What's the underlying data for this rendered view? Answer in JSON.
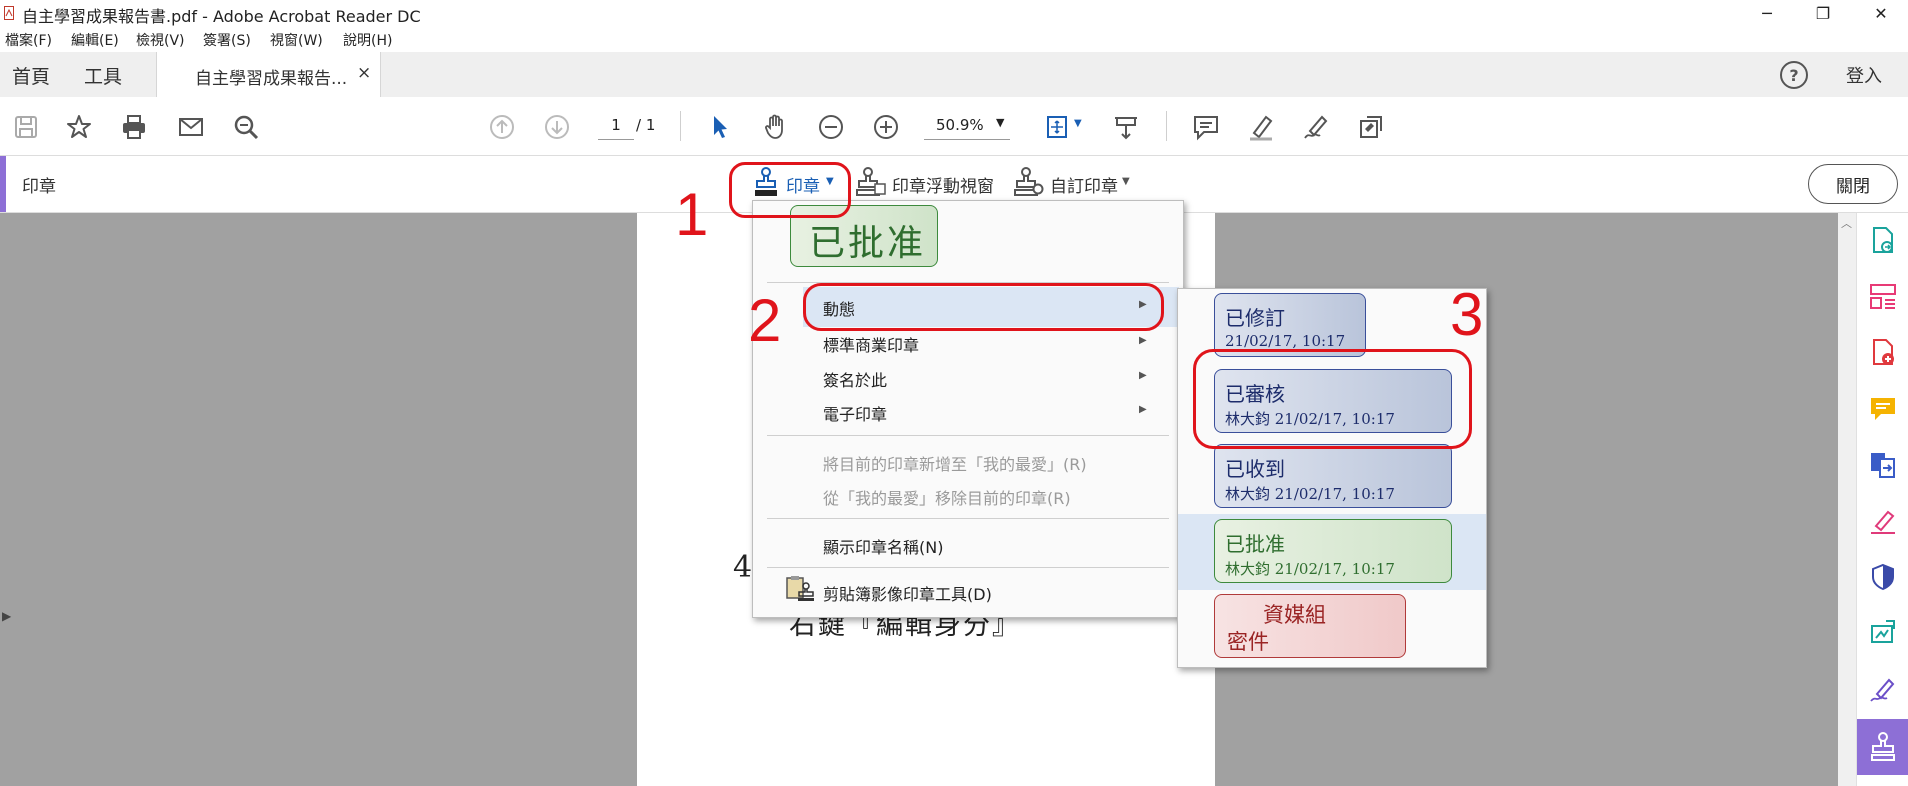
{
  "window": {
    "title": "自主學習成果報告書.pdf - Adobe Acrobat Reader DC",
    "minimize": "─",
    "restore": "❐",
    "close": "✕"
  },
  "menu": [
    "檔案(F)",
    "編輯(E)",
    "檢視(V)",
    "簽署(S)",
    "視窗(W)",
    "說明(H)"
  ],
  "tabs": {
    "home": "首頁",
    "tools": "工具",
    "document": "自主學習成果報告...",
    "close": "×",
    "help": "?",
    "signin": "登入"
  },
  "toolbar": {
    "page_current": "1",
    "page_total": "/ 1",
    "zoom": "50.9%",
    "icons": [
      "save-icon",
      "star-icon",
      "print-icon",
      "mail-icon",
      "search-icon",
      "prev-page-icon",
      "next-page-icon",
      "select-arrow-icon",
      "hand-icon",
      "zoom-out-icon",
      "zoom-in-icon",
      "fit-icon",
      "scroll-icon",
      "comment-icon",
      "highlight-icon",
      "sign-icon",
      "stamp-edit-icon"
    ]
  },
  "stampbar": {
    "title": "印章",
    "stamp": "印章",
    "floating": "印章浮動視窗",
    "custom": "自訂印章",
    "close": "關閉"
  },
  "document": {
    "text1": "4",
    "text2": "右鍵『編輯身分』"
  },
  "stamp_menu": {
    "recent_stamp": "已批准",
    "items": [
      {
        "label": "動態",
        "submenu": true
      },
      {
        "label": "標準商業印章",
        "submenu": true
      },
      {
        "label": "簽名於此",
        "submenu": true
      },
      {
        "label": "電子印章",
        "submenu": true
      }
    ],
    "add_favorite": "將目前的印章新增至「我的最愛」(R)",
    "remove_favorite": "從「我的最愛」移除目前的印章(R)",
    "show_names": "顯示印章名稱(N)",
    "clipboard": "剪貼簿影像印章工具(D)"
  },
  "dynamic_stamps": [
    {
      "title": "已修訂",
      "detail": "21/02/17, 10:17",
      "color": "blue"
    },
    {
      "title": "已審核",
      "detail": "林大鈞 21/02/17, 10:17",
      "color": "blue"
    },
    {
      "title": "已收到",
      "detail": "林大鈞 21/02/17, 10:17",
      "color": "blue"
    },
    {
      "title": "已批准",
      "detail": "林大鈞 21/02/17, 10:17",
      "color": "green"
    },
    {
      "title": "資媒組",
      "detail": "密件",
      "color": "red"
    }
  ],
  "annotations": [
    "1",
    "2",
    "3"
  ],
  "colors": {
    "accent_purple": "#8d6fd6",
    "annotation_red": "#e0141b",
    "link_blue": "#1a5fb4"
  }
}
